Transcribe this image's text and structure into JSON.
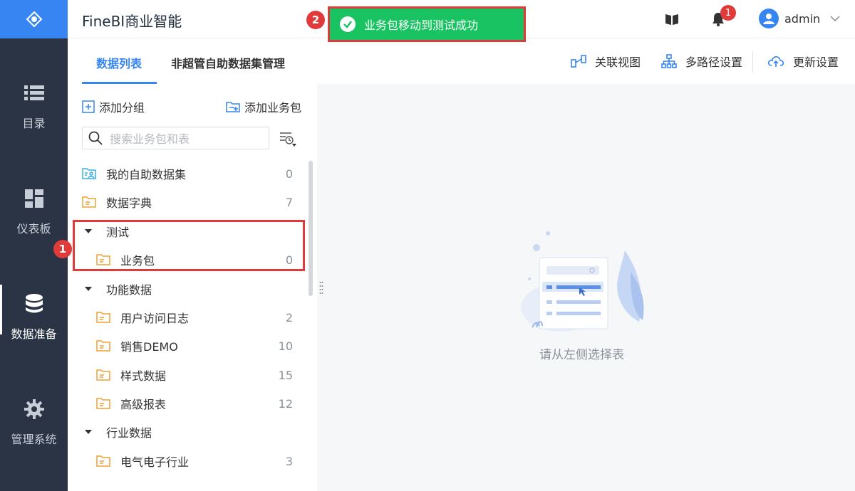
{
  "app_title": "FineBI商业智能",
  "toast": {
    "message": "业务包移动到测试成功",
    "callout": "2"
  },
  "header": {
    "notifications_count": "1",
    "user_name": "admin"
  },
  "leftnav": [
    {
      "label": "目录",
      "icon": "list-icon"
    },
    {
      "label": "仪表板",
      "icon": "dashboard-icon"
    },
    {
      "label": "数据准备",
      "icon": "database-icon",
      "active": true
    },
    {
      "label": "管理系统",
      "icon": "gear-icon"
    }
  ],
  "tabs": [
    {
      "label": "数据列表",
      "active": true
    },
    {
      "label": "非超管自助数据集管理"
    }
  ],
  "toolbar": {
    "relation_view": "关联视图",
    "multi_path": "多路径设置",
    "update_settings": "更新设置"
  },
  "panel": {
    "add_group": "添加分组",
    "add_package": "添加业务包",
    "search_placeholder": "搜索业务包和表",
    "items": [
      {
        "label": "我的自助数据集",
        "count": "0"
      },
      {
        "label": "数据字典",
        "count": "7"
      },
      {
        "label": "测试"
      },
      {
        "label": "业务包",
        "count": "0"
      },
      {
        "label": "功能数据"
      },
      {
        "label": "用户访问日志",
        "count": "2"
      },
      {
        "label": "销售DEMO",
        "count": "10"
      },
      {
        "label": "样式数据",
        "count": "15"
      },
      {
        "label": "高级报表",
        "count": "12"
      },
      {
        "label": "行业数据"
      },
      {
        "label": "电气电子行业",
        "count": "3"
      }
    ],
    "callout": "1"
  },
  "main": {
    "empty_text": "请从左侧选择表"
  },
  "colors": {
    "accent": "#3685f2",
    "nav_bg": "#2b3444",
    "toast_bg": "#19c362",
    "callout": "#e03a3a",
    "folder": "#f0a030"
  }
}
